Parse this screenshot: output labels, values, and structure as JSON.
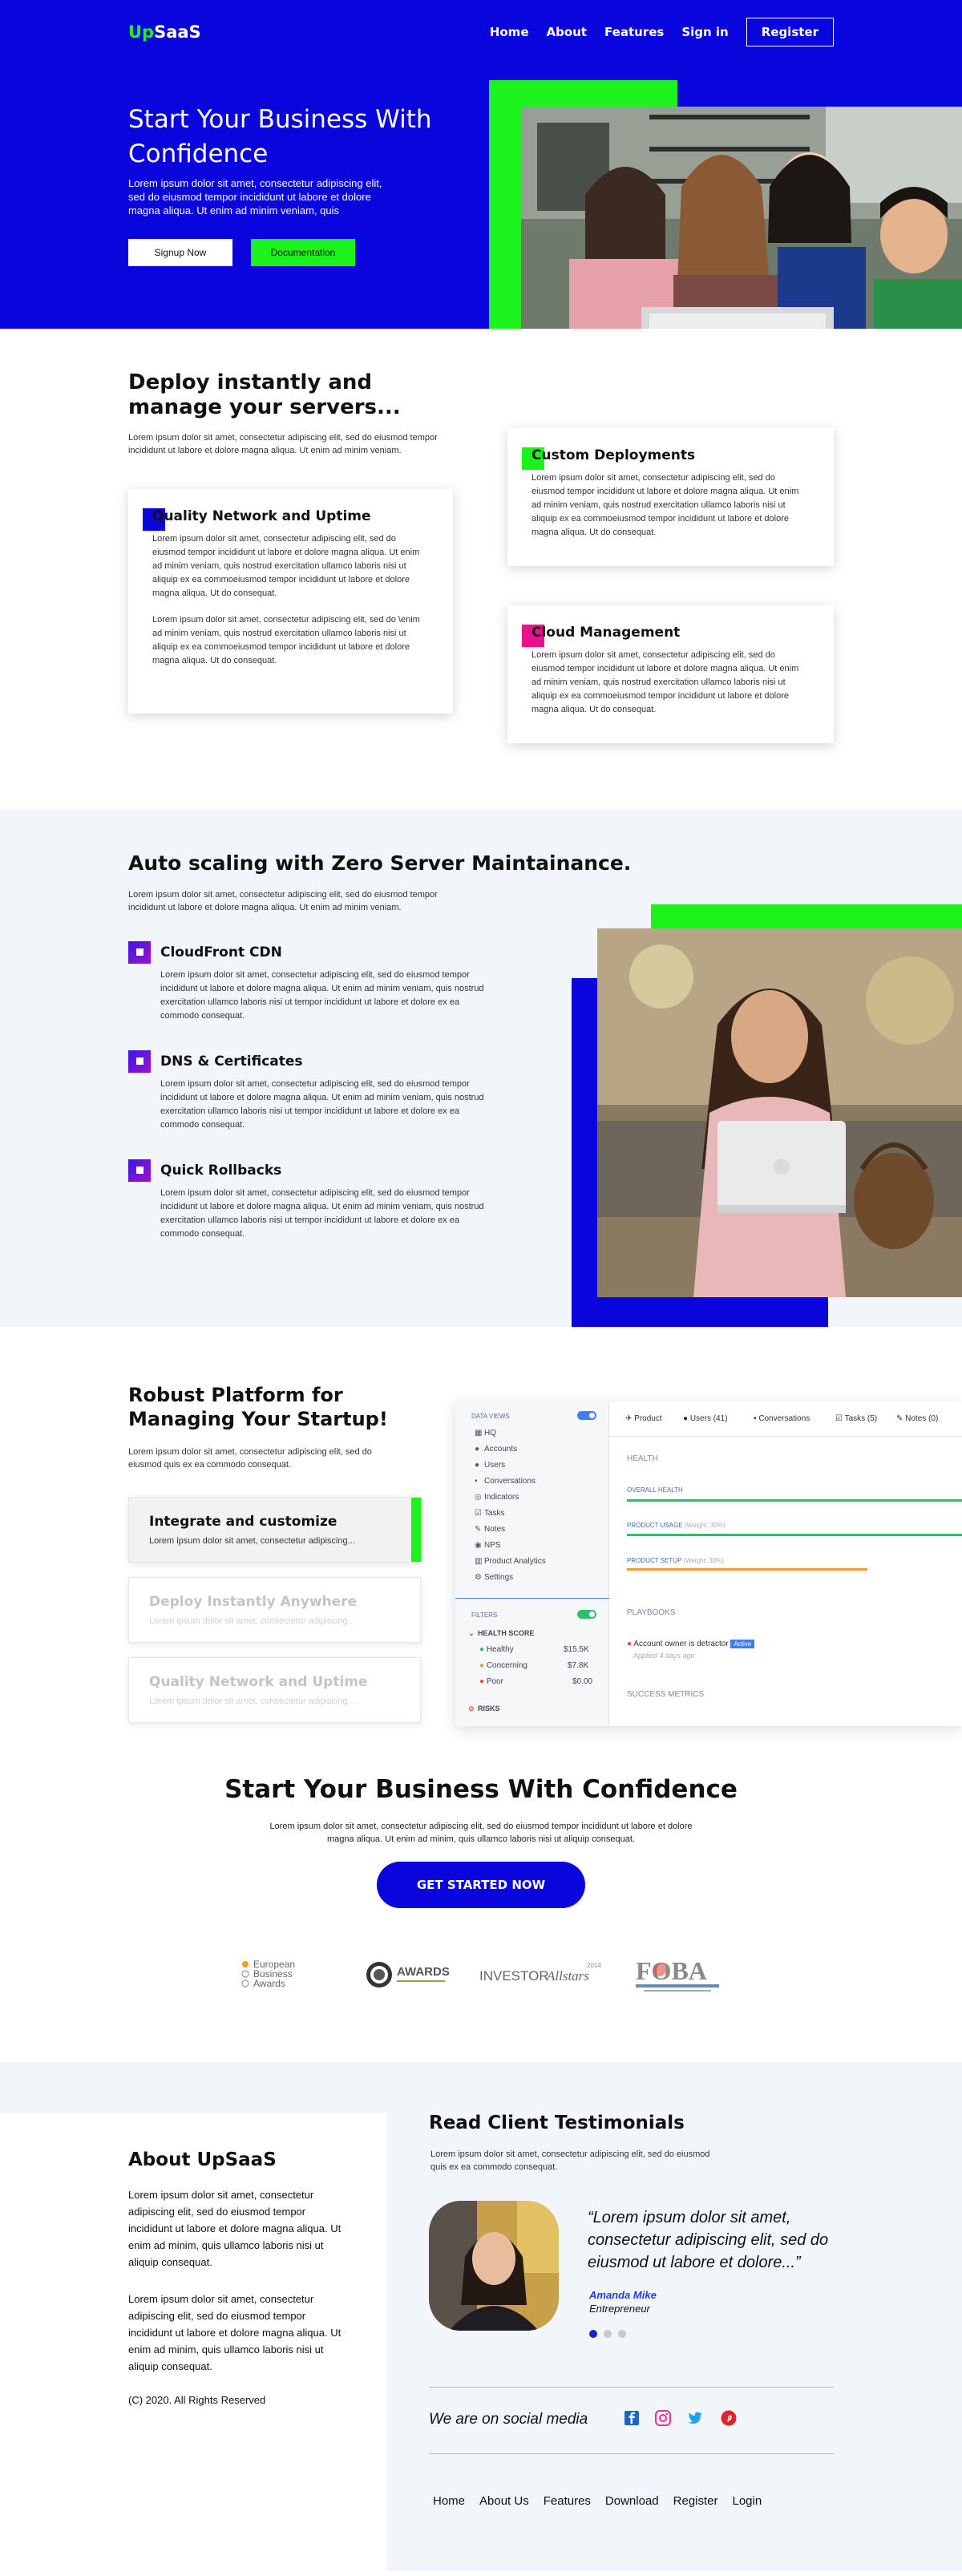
{
  "nav": {
    "logo_up": "Up",
    "logo_rest": "SaaS",
    "links": [
      "Home",
      "About",
      "Features",
      "Sign in"
    ],
    "register": "Register"
  },
  "hero": {
    "title": "Start Your Business With Confidence",
    "text": "Lorem ipsum dolor sit amet, consectetur adipiscing elit, sed do eiusmod tempor incididunt ut labore et dolore magna aliqua. Ut enim ad minim veniam, quis",
    "signup": "Signup Now",
    "docs": "Documentation"
  },
  "deploy": {
    "title": "Deploy instantly and manage your servers...",
    "lead": "Lorem ipsum dolor sit amet, consectetur adipiscing elit, sed do eiusmod tempor incididunt ut labore et dolore magna aliqua. Ut enim ad minim veniam.",
    "quality": {
      "title": "Quality Network and Uptime",
      "p1": "Lorem ipsum dolor sit amet, consectetur adipiscing elit, sed do eiusmod tempor incididunt ut labore et dolore magna aliqua. Ut enim ad minim veniam, quis nostrud exercitation ullamco laboris nisi ut aliquip ex ea commoeiusmod tempor incididunt ut labore et dolore magna aliqua. Ut do consequat.",
      "p2": "Lorem ipsum dolor sit amet, consectetur adipiscing elit, sed do \\enim ad minim veniam, quis nostrud exercitation ullamco laboris nisi ut aliquip ex ea commoeiusmod tempor incididunt ut labore et dolore magna aliqua. Ut do consequat."
    },
    "custom": {
      "title": "Custom Deployments",
      "text": "Lorem ipsum dolor sit amet, consectetur adipiscing elit, sed do eiusmod tempor incididunt ut labore et dolore magna aliqua. Ut enim ad minim veniam, quis nostrud exercitation ullamco laboris nisi ut aliquip ex ea commoeiusmod tempor incididunt ut labore et dolore magna aliqua. Ut do consequat."
    },
    "cloud": {
      "title": "Cloud Management",
      "text": "Lorem ipsum dolor sit amet, consectetur adipiscing elit, sed do eiusmod tempor incididunt ut labore et dolore magna aliqua. Ut enim ad minim veniam, quis nostrud exercitation ullamco laboris nisi ut aliquip ex ea commoeiusmod tempor incididunt ut labore et dolore magna aliqua. Ut do consequat."
    }
  },
  "scaling": {
    "title": "Auto scaling with Zero Server Maintainance.",
    "lead": "Lorem ipsum dolor sit amet, consectetur adipiscing elit, sed do eiusmod tempor incididunt ut labore et dolore magna aliqua. Ut enim ad minim veniam.",
    "features": [
      {
        "title": "CloudFront CDN",
        "text": "Lorem ipsum dolor sit amet, consectetur adipiscing elit, sed do eiusmod tempor incididunt ut labore et dolore magna aliqua. Ut enim ad minim veniam, quis nostrud exercitation ullamco laboris nisi ut tempor incididunt ut labore et dolore ex ea commodo consequat."
      },
      {
        "title": "DNS & Certificates",
        "text": "Lorem ipsum dolor sit amet, consectetur adipiscing elit, sed do eiusmod tempor incididunt ut labore et dolore magna aliqua. Ut enim ad minim veniam, quis nostrud exercitation ullamco laboris nisi ut tempor incididunt ut labore et dolore ex ea commodo consequat."
      },
      {
        "title": "Quick Rollbacks",
        "text": "Lorem ipsum dolor sit amet, consectetur adipiscing elit, sed do eiusmod tempor incididunt ut labore et dolore magna aliqua. Ut enim ad minim veniam, quis nostrud exercitation ullamco laboris nisi ut tempor incididunt ut labore et dolore ex ea commodo consequat."
      }
    ]
  },
  "platform": {
    "title": "Robust Platform for Managing Your Startup!",
    "lead": "Lorem ipsum dolor sit amet, consectetur adipiscing elit, sed do eiusmod quis ex ea commodo consequat.",
    "items": [
      {
        "title": "Integrate and customize",
        "text": "Lorem ipsum dolor sit amet, consectetur adipiscing..."
      },
      {
        "title": "Deploy Instantly Anywhere",
        "text": "Lorem ipsum dolor sit amet, consectetur adipiscing..."
      },
      {
        "title": "Quality Network and Uptime",
        "text": "Lorem ipsum dolor sit amet, consectetur adipiscing..."
      }
    ],
    "dashboard": {
      "data_views": "DATA VIEWS",
      "menu": [
        "HQ",
        "Accounts",
        "Users",
        "Conversations",
        "Indicators",
        "Tasks",
        "Notes",
        "NPS",
        "Product Analytics",
        "Settings"
      ],
      "filters": "FILTERS",
      "health_score": "HEALTH SCORE",
      "rows": [
        {
          "label": "Healthy",
          "value": "$15.5K",
          "color": "#2dc06a"
        },
        {
          "label": "Concerning",
          "value": "$7.8K",
          "color": "#f0a030"
        },
        {
          "label": "Poor",
          "value": "$0.00",
          "color": "#e84b3c"
        }
      ],
      "risks": "RISKS",
      "tabs": [
        "Product",
        "Users (41)",
        "Conversations",
        "Tasks (5)",
        "Notes (0)"
      ],
      "health": "HEALTH",
      "overall": "OVERALL HEALTH",
      "usage": "PRODUCT USAGE",
      "usage_weight": "(Weight: 30%)",
      "setup": "PRODUCT SETUP",
      "setup_weight": "(Weight: 30%)",
      "playbooks": "PLAYBOOKS",
      "playbook_item": "Account owner is detractor",
      "playbook_badge": "Active",
      "playbook_time": "Applied 4 days ago",
      "success": "SUCCESS METRICS"
    }
  },
  "cta": {
    "title": "Start Your Business With Confidence",
    "text": "Lorem ipsum dolor sit amet, consectetur adipiscing elit, sed do eiusmod tempor incididunt ut labore et dolore magna aliqua. Ut enim ad minim, quis ullamco laboris nisi ut aliquip consequat.",
    "button": "GET STARTED NOW",
    "awards": {
      "eba": [
        "European",
        "Business",
        "Awards"
      ],
      "awards_text": "AWARDS",
      "investor": "INVESTOR",
      "allstars": "Allstars",
      "year": "2014",
      "foba": "FOBA"
    }
  },
  "about": {
    "title": "About UpSaaS",
    "p1": "Lorem ipsum dolor sit amet, consectetur adipiscing elit, sed do eiusmod tempor incididunt ut labore et dolore magna aliqua. Ut enim ad minim, quis ullamco laboris nisi ut aliquip consequat.",
    "p2": "Lorem ipsum dolor sit amet, consectetur adipiscing elit, sed do eiusmod tempor incididunt ut labore et dolore magna aliqua. Ut enim ad minim, quis ullamco laboris nisi ut aliquip consequat.",
    "copyright": "(C) 2020. All Rights Reserved"
  },
  "testimonials": {
    "title": "Read Client Testimonials",
    "lead": "Lorem ipsum dolor sit amet, consectetur adipiscing elit, sed do eiusmod quis ex ea commodo consequat.",
    "quote": "“Lorem ipsum dolor sit amet, consectetur adipiscing elit, sed do eiusmod ut labore et dolore...”",
    "name": "Amanda Mike",
    "role": "Entrepreneur",
    "social": "We are on social media",
    "footer_links": [
      "Home",
      "About Us",
      "Features",
      "Download",
      "Register",
      "Login"
    ]
  },
  "colors": {
    "primary": "#0a05dc",
    "accent": "#1cf21c",
    "background_light": "#f2f5f9"
  }
}
